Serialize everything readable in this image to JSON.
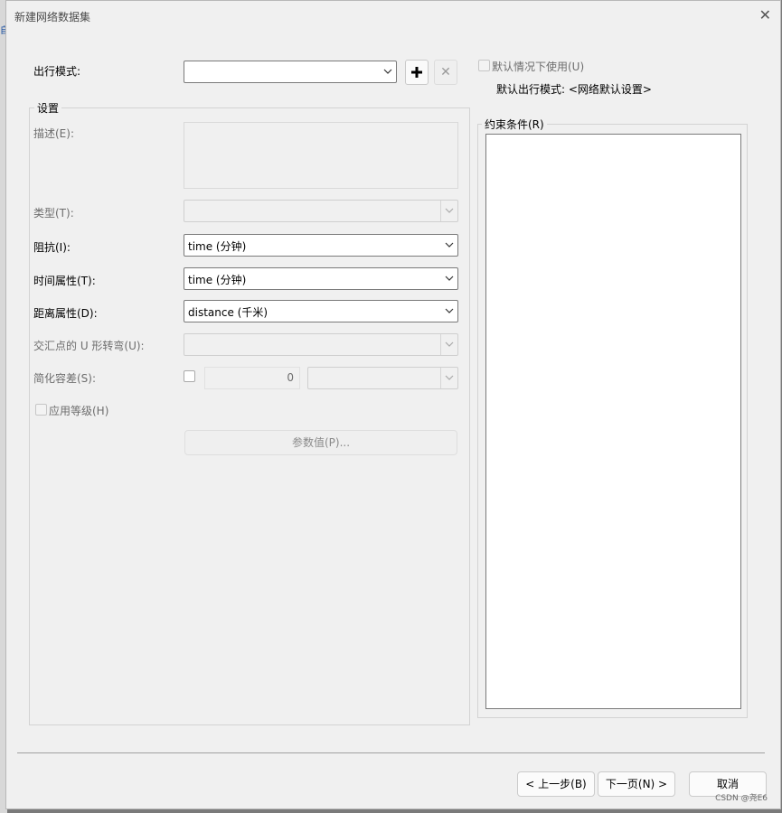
{
  "dialog": {
    "title": "新建网络数据集"
  },
  "travel_mode": {
    "label": "出行模式:",
    "value": "",
    "use_default_label": "默认情况下使用(U)",
    "default_mode_text": "默认出行模式: <网络默认设置>"
  },
  "settings": {
    "group_title": "设置",
    "description_label": "描述(E):",
    "type_label": "类型(T):",
    "type_value": "",
    "impedance_label": "阻抗(I):",
    "impedance_value": "time (分钟)",
    "time_attr_label": "时间属性(T):",
    "time_attr_value": "time (分钟)",
    "distance_attr_label": "距离属性(D):",
    "distance_attr_value": "distance (千米)",
    "uturn_label": "交汇点的 U 形转弯(U):",
    "uturn_value": "",
    "simplify_label": "简化容差(S):",
    "simplify_value": "0",
    "hierarchy_label": "应用等级(H)",
    "params_button": "参数值(P)..."
  },
  "restrictions": {
    "title": "约束条件(R)"
  },
  "footer": {
    "back_label": "< 上一步(B)",
    "next_label": "下一页(N) >",
    "cancel_label": "取消",
    "watermark": "CSDN @尧E6"
  }
}
